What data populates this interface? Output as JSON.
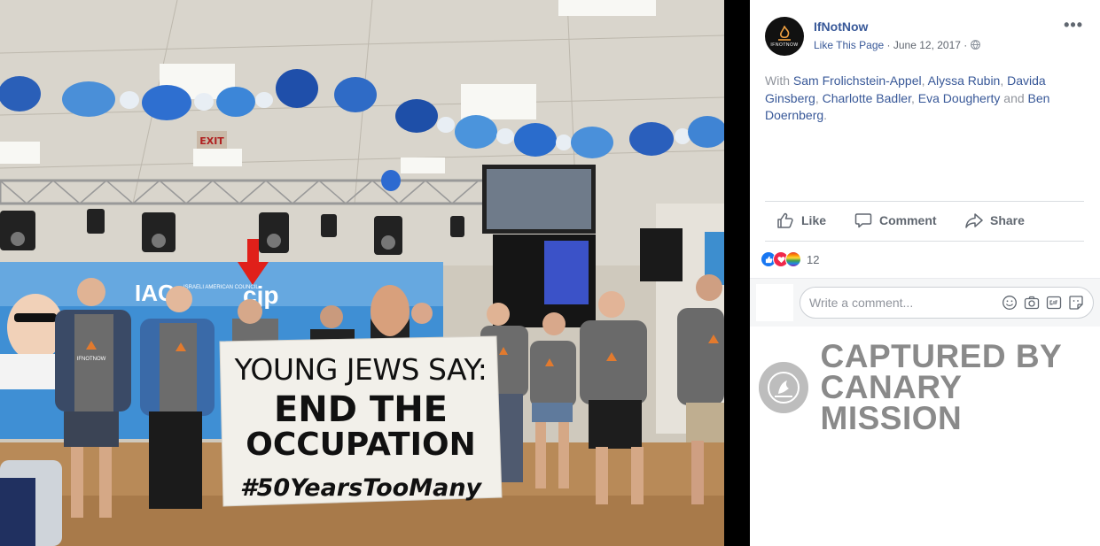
{
  "photo": {
    "exit_sign": "EXIT",
    "org_logo_left": "IAC",
    "org_subtitle": "ISRAELI AMERICAN COUNCIL",
    "org_logo_right": "cjp",
    "banner": {
      "line1": "YOUNG JEWS SAY:",
      "line2": "END THE",
      "line3": "OCCUPATION",
      "line4": "#50YearsTooMany"
    },
    "shirt_text": "IFNOTNOW"
  },
  "post": {
    "page_name": "IfNotNow",
    "avatar_caption": "IFNOTNOW",
    "like_page": "Like This Page",
    "separator": "·",
    "date": "June 12, 2017",
    "audience_icon": "globe-icon",
    "more_icon": "•••",
    "with_prefix": "With",
    "tagged": [
      "Sam Frolichstein-Appel",
      "Alyssa Rubin",
      "Davida Ginsberg",
      "Charlotte Badler",
      "Eva Dougherty",
      "Ben Doernberg"
    ],
    "sep_comma": ",",
    "sep_and": "and",
    "period": ".",
    "actions": {
      "like": "Like",
      "comment": "Comment",
      "share": "Share"
    },
    "reaction_count": "12",
    "comment_placeholder": "Write a comment...",
    "comment_icons": [
      "emoji-icon",
      "camera-icon",
      "gif-icon",
      "sticker-icon"
    ]
  },
  "watermark": {
    "line1": "CAPTURED BY",
    "line2": "CANARY MISSION"
  },
  "colors": {
    "fb_blue": "#385898",
    "text_gray": "#90949c",
    "panel_bg": "#ffffff",
    "arrow_red": "#e0201a"
  }
}
